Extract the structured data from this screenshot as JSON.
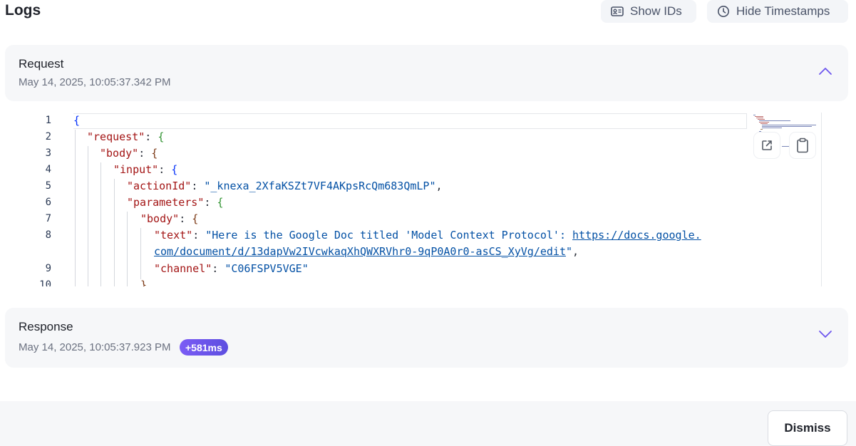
{
  "header": {
    "title": "Logs",
    "show_ids_label": "Show IDs",
    "hide_timestamps_label": "Hide Timestamps"
  },
  "request": {
    "title": "Request",
    "timestamp": "May 14, 2025, 10:05:37.342 PM",
    "code_lines": [
      {
        "n": "1"
      },
      {
        "n": "2"
      },
      {
        "n": "3"
      },
      {
        "n": "4"
      },
      {
        "n": "5"
      },
      {
        "n": "6"
      },
      {
        "n": "7"
      },
      {
        "n": "8"
      },
      {
        "n": ""
      },
      {
        "n": "9"
      },
      {
        "n": "10"
      }
    ],
    "keys": {
      "request": "\"request\"",
      "body": "\"body\"",
      "input": "\"input\"",
      "actionId": "\"actionId\"",
      "parameters": "\"parameters\"",
      "text": "\"text\"",
      "channel": "\"channel\""
    },
    "values": {
      "actionId": "\"_knexa_2XfaKSZt7VF4AKpsRcQm683QmLP\"",
      "text_prefix": "\"Here is the Google Doc titled 'Model Context Protocol': ",
      "text_link_part1": "https://docs.google.",
      "text_link_part2": "com/document/d/13dapVw2IVcwkaqXhQWXRVhr0-9qP0A0r0-asCS_XyVg/edit",
      "text_suffix": "\"",
      "channel": "\"C06FSPV5VGE\""
    }
  },
  "response": {
    "title": "Response",
    "timestamp": "May 14, 2025, 10:05:37.923 PM",
    "latency_badge": "+581ms"
  },
  "footer": {
    "dismiss_label": "Dismiss"
  },
  "colors": {
    "accent": "#6c55ee",
    "key": "#a31515",
    "string": "#0451a5"
  }
}
